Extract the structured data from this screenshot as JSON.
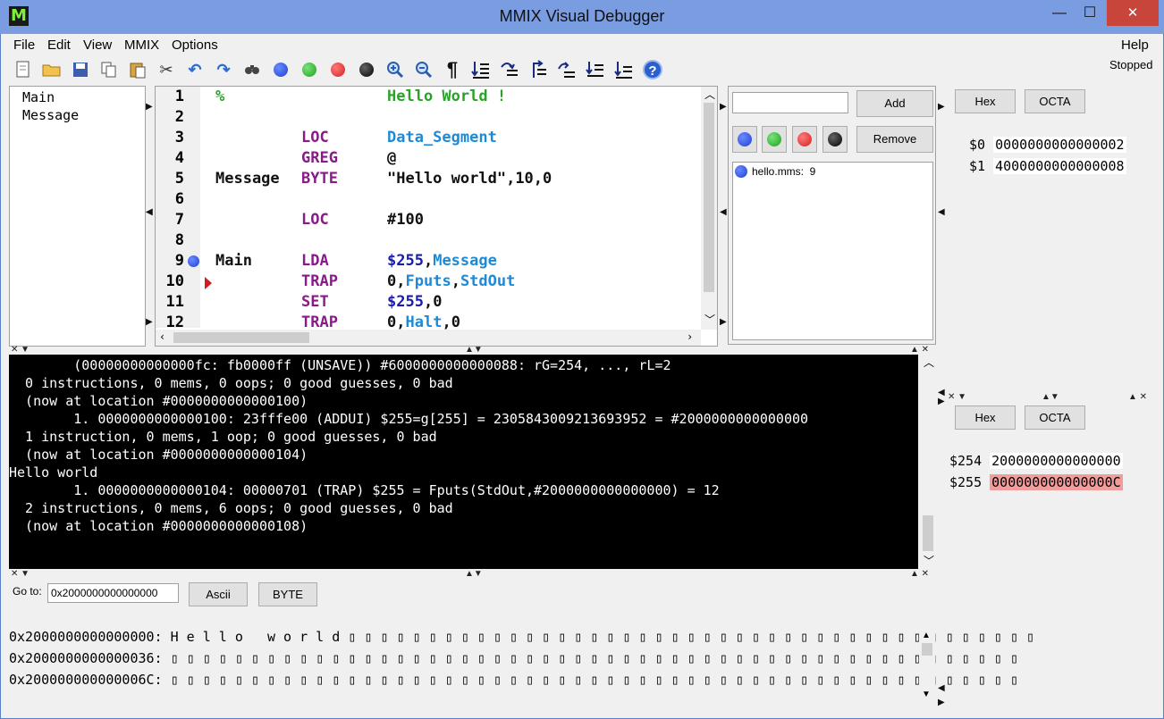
{
  "window": {
    "title": "MMIX Visual Debugger",
    "logo": "M",
    "minimize": "—",
    "maximize": "☐",
    "close": "✕"
  },
  "menu": [
    "File",
    "Edit",
    "View",
    "MMIX",
    "Options"
  ],
  "help_label": "Help",
  "status": "Stopped",
  "symbols": [
    "Main",
    "Message"
  ],
  "source": [
    {
      "n": "1",
      "label": "%",
      "op": "",
      "arg": "Hello World !",
      "comment": true
    },
    {
      "n": "2",
      "label": "",
      "op": "",
      "arg": ""
    },
    {
      "n": "3",
      "label": "",
      "op": "LOC",
      "arg": "Data_Segment"
    },
    {
      "n": "4",
      "label": "",
      "op": "GREG",
      "arg": "@"
    },
    {
      "n": "5",
      "label": "Message",
      "op": "BYTE",
      "arg": "\"Hello world\",10,0"
    },
    {
      "n": "6",
      "label": "",
      "op": "",
      "arg": ""
    },
    {
      "n": "7",
      "label": "",
      "op": "LOC",
      "arg": "#100"
    },
    {
      "n": "8",
      "label": "",
      "op": "",
      "arg": ""
    },
    {
      "n": "9",
      "label": "Main",
      "op": "LDA",
      "arg": "$255,Message",
      "breakpoint": true
    },
    {
      "n": "10",
      "label": "",
      "op": "TRAP",
      "arg": "0,Fputs,StdOut",
      "current": true
    },
    {
      "n": "11",
      "label": "",
      "op": "SET",
      "arg": "$255,0"
    },
    {
      "n": "12",
      "label": "",
      "op": "TRAP",
      "arg": "0,Halt,0"
    }
  ],
  "breakpoints": {
    "add_label": "Add",
    "remove_label": "Remove",
    "input_value": "",
    "colors": [
      "#1f3fd6",
      "#22b522",
      "#d61f1f",
      "#111111"
    ],
    "entries": [
      "hello.mms:  9"
    ]
  },
  "registers_top": {
    "hex_label": "Hex",
    "octa_label": "OCTA",
    "rows": [
      {
        "name": "$0",
        "value": "0000000000000002"
      },
      {
        "name": "$1",
        "value": "4000000000000008"
      }
    ]
  },
  "registers_bottom": {
    "hex_label": "Hex",
    "octa_label": "OCTA",
    "rows": [
      {
        "name": "$254",
        "value": "2000000000000000"
      },
      {
        "name": "$255",
        "value": "000000000000000C",
        "highlight": true
      }
    ]
  },
  "console": [
    "        (00000000000000fc: fb0000ff (UNSAVE)) #6000000000000088: rG=254, ..., rL=2",
    "  0 instructions, 0 mems, 0 oops; 0 good guesses, 0 bad",
    "  (now at location #0000000000000100)",
    "        1. 0000000000000100: 23fffe00 (ADDUI) $255=g[255] = 2305843009213693952 = #2000000000000000",
    "  1 instruction, 0 mems, 1 oop; 0 good guesses, 0 bad",
    "  (now at location #0000000000000104)",
    "Hello world",
    "        1. 0000000000000104: 00000701 (TRAP) $255 = Fputs(StdOut,#2000000000000000) = 12",
    "  2 instructions, 0 mems, 6 oops; 0 good guesses, 0 bad",
    "  (now at location #0000000000000108)"
  ],
  "memory": {
    "goto_label": "Go to:",
    "goto_value": "0x2000000000000000",
    "ascii_label": "Ascii",
    "byte_label": "BYTE",
    "rows": [
      "0x2000000000000000: H e l l o   w o r l d ▯ ▯ ▯ ▯ ▯ ▯ ▯ ▯ ▯ ▯ ▯ ▯ ▯ ▯ ▯ ▯ ▯ ▯ ▯ ▯ ▯ ▯ ▯ ▯ ▯ ▯ ▯ ▯ ▯ ▯ ▯ ▯ ▯ ▯ ▯ ▯ ▯ ▯ ▯ ▯ ▯ ▯ ▯",
      "0x2000000000000036: ▯ ▯ ▯ ▯ ▯ ▯ ▯ ▯ ▯ ▯ ▯ ▯ ▯ ▯ ▯ ▯ ▯ ▯ ▯ ▯ ▯ ▯ ▯ ▯ ▯ ▯ ▯ ▯ ▯ ▯ ▯ ▯ ▯ ▯ ▯ ▯ ▯ ▯ ▯ ▯ ▯ ▯ ▯ ▯ ▯ ▯ ▯ ▯ ▯ ▯ ▯ ▯ ▯",
      "0x200000000000006C: ▯ ▯ ▯ ▯ ▯ ▯ ▯ ▯ ▯ ▯ ▯ ▯ ▯ ▯ ▯ ▯ ▯ ▯ ▯ ▯ ▯ ▯ ▯ ▯ ▯ ▯ ▯ ▯ ▯ ▯ ▯ ▯ ▯ ▯ ▯ ▯ ▯ ▯ ▯ ▯ ▯ ▯ ▯ ▯ ▯ ▯ ▯ ▯ ▯ ▯ ▯ ▯ ▯"
    ]
  },
  "toolbar_icons": [
    "new-file-icon",
    "open-folder-icon",
    "save-icon",
    "copy-icon",
    "paste-icon",
    "cut-icon",
    "undo-icon",
    "redo-icon",
    "find-icon",
    "blue-breakpoint-icon",
    "green-breakpoint-icon",
    "red-breakpoint-icon",
    "black-breakpoint-icon",
    "zoom-in-icon",
    "zoom-out-icon",
    "pilcrow-icon",
    "step-icon",
    "step-over-icon",
    "step-out-icon",
    "run-icon",
    "step-back-icon",
    "continue-icon",
    "help-icon"
  ]
}
